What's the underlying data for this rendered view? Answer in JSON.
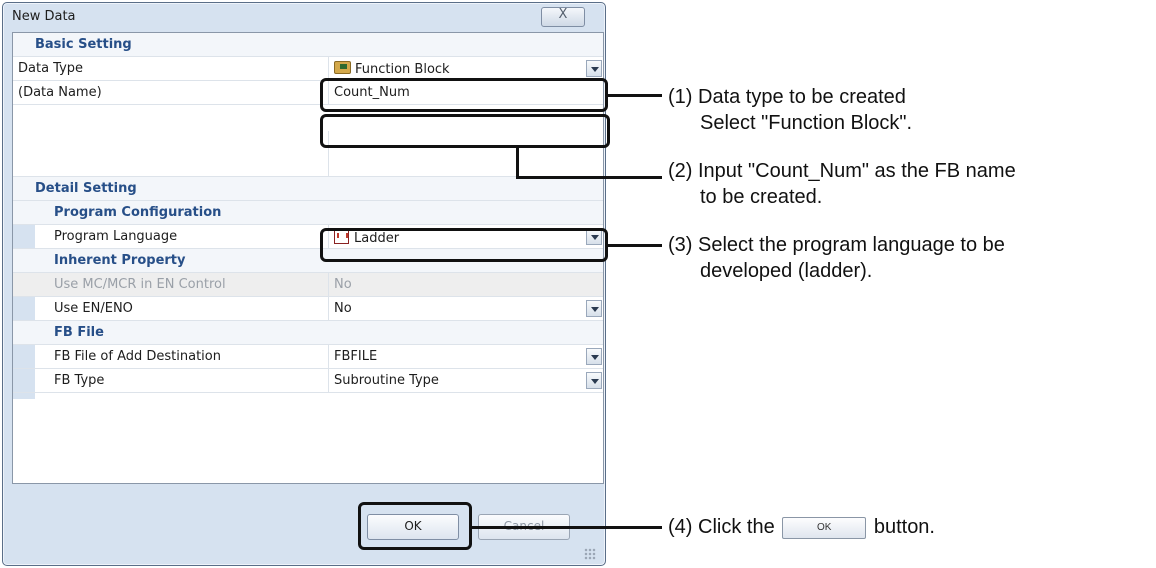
{
  "dialog": {
    "title": "New Data",
    "close_glyph": "X"
  },
  "basic": {
    "header": "Basic Setting",
    "data_type_label": "Data Type",
    "data_type_value": "Function Block",
    "data_type_icon": "function-block-icon",
    "data_name_label": "(Data Name)",
    "data_name_value": "Count_Num"
  },
  "detail": {
    "header": "Detail Setting",
    "program_config_header": "Program Configuration",
    "program_language_label": "Program Language",
    "program_language_value": "Ladder",
    "program_language_icon": "ladder-icon",
    "inherent_header": "Inherent Property",
    "use_mc_label": "Use MC/MCR in EN Control",
    "use_mc_value": "No",
    "use_en_label": "Use EN/ENO",
    "use_en_value": "No",
    "fb_file_header": "FB File",
    "fb_dest_label": "FB File of Add Destination",
    "fb_dest_value": "FBFILE",
    "fb_type_label": "FB Type",
    "fb_type_value": "Subroutine Type"
  },
  "buttons": {
    "ok": "OK",
    "cancel": "Cancel"
  },
  "annotations": {
    "a1_line1": "(1) Data type to be created",
    "a1_line2": "Select \"Function Block\".",
    "a2_line1": "(2) Input \"Count_Num\" as the FB name",
    "a2_line2": "to be created.",
    "a3_line1": "(3) Select the program language to be",
    "a3_line2": "developed (ladder).",
    "a4_before": "(4) Click the",
    "a4_button": "OK",
    "a4_after": "button."
  }
}
